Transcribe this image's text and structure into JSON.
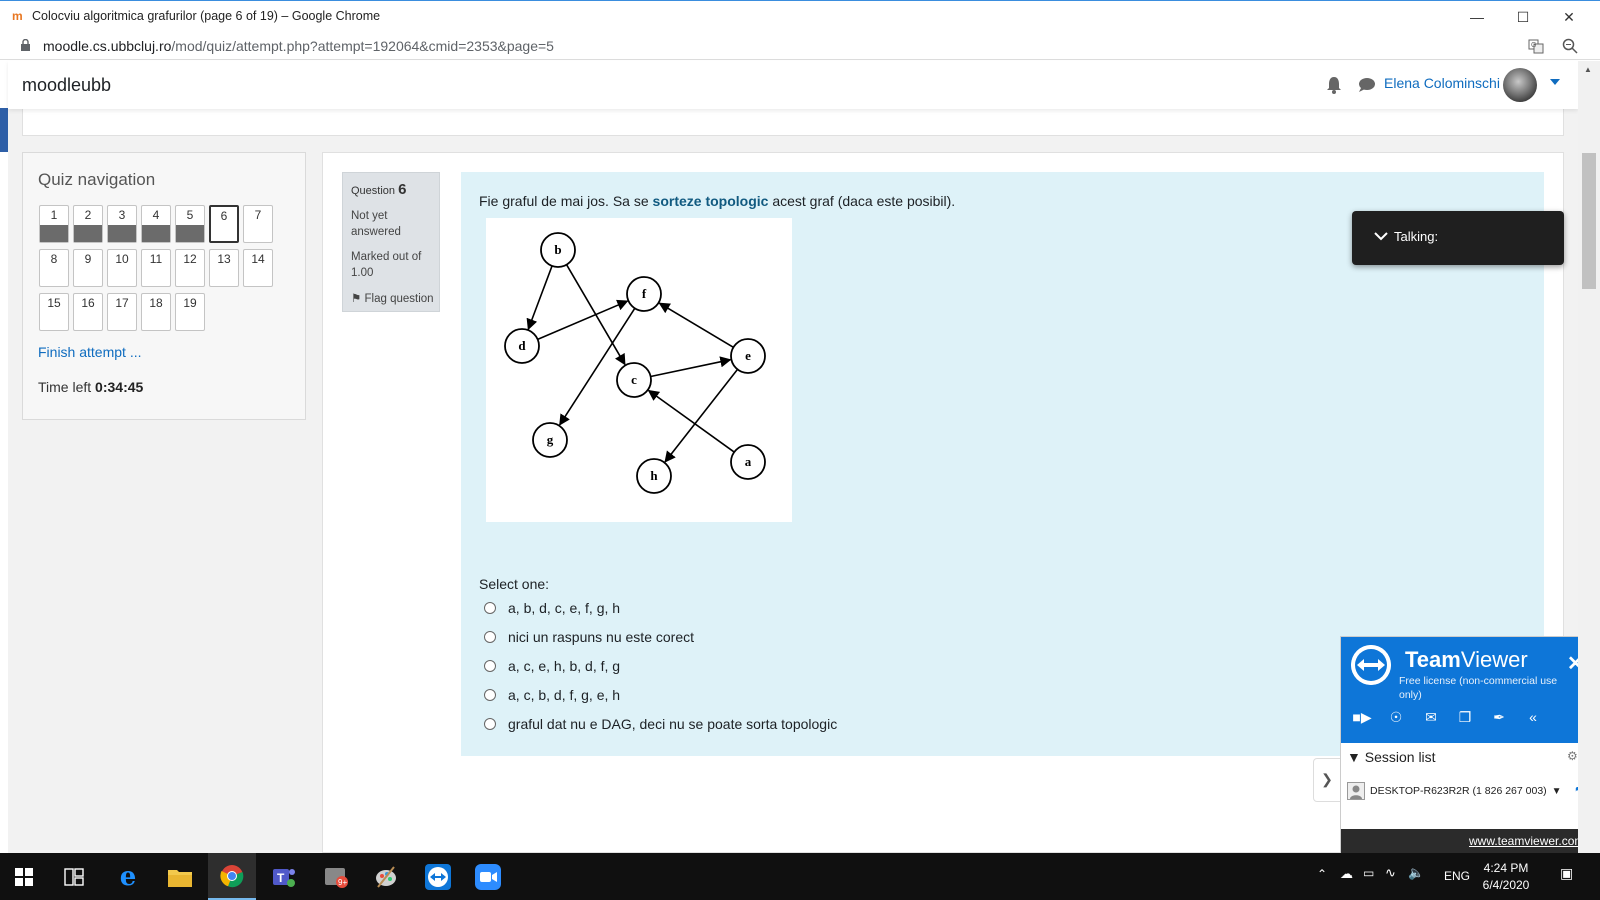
{
  "window": {
    "title": "Colocviu algoritmica grafurilor (page 6 of 19) – Google Chrome",
    "url_host": "moodle.cs.ubbcluj.ro",
    "url_path": "/mod/quiz/attempt.php?attempt=192064&cmid=2353&page=5"
  },
  "header": {
    "brand": "moodleubb",
    "user_name": "Elena Colominschi"
  },
  "quiz_nav": {
    "title": "Quiz navigation",
    "questions": [
      {
        "n": "1",
        "state": "answered"
      },
      {
        "n": "2",
        "state": "answered"
      },
      {
        "n": "3",
        "state": "answered"
      },
      {
        "n": "4",
        "state": "answered"
      },
      {
        "n": "5",
        "state": "answered"
      },
      {
        "n": "6",
        "state": "current"
      },
      {
        "n": "7",
        "state": "unanswered"
      },
      {
        "n": "8",
        "state": "unanswered"
      },
      {
        "n": "9",
        "state": "unanswered"
      },
      {
        "n": "10",
        "state": "unanswered"
      },
      {
        "n": "11",
        "state": "unanswered"
      },
      {
        "n": "12",
        "state": "unanswered"
      },
      {
        "n": "13",
        "state": "unanswered"
      },
      {
        "n": "14",
        "state": "unanswered"
      },
      {
        "n": "15",
        "state": "unanswered"
      },
      {
        "n": "16",
        "state": "unanswered"
      },
      {
        "n": "17",
        "state": "unanswered"
      },
      {
        "n": "18",
        "state": "unanswered"
      },
      {
        "n": "19",
        "state": "unanswered"
      }
    ],
    "finish_label": "Finish attempt ...",
    "time_left_label": "Time left",
    "time_left_value": "0:34:45"
  },
  "question": {
    "label": "Question",
    "number": "6",
    "state": "Not yet answered",
    "marks": "Marked out of 1.00",
    "flag": "Flag question",
    "text_before": "Fie graful de mai jos. Sa se ",
    "text_bold": "sorteze topologic",
    "text_after": " acest graf (daca este posibil).",
    "prompt": "Select one:",
    "options": [
      "a, b, d, c, e, f, g, h",
      "nici un raspuns nu este corect",
      "a, c, e, h, b, d, f, g",
      "a, c, b, d, f, g, e, h",
      "graful dat nu e DAG, deci nu se poate sorta topologic"
    ]
  },
  "graph": {
    "nodes": [
      "b",
      "f",
      "d",
      "c",
      "e",
      "g",
      "h",
      "a"
    ],
    "edges": [
      [
        "b",
        "d"
      ],
      [
        "b",
        "c"
      ],
      [
        "d",
        "f"
      ],
      [
        "f",
        "g"
      ],
      [
        "e",
        "f"
      ],
      [
        "c",
        "e"
      ],
      [
        "e",
        "h"
      ],
      [
        "a",
        "c"
      ]
    ]
  },
  "talking": {
    "label": "Talking:"
  },
  "teamviewer": {
    "name_bold": "Team",
    "name_rest": "Viewer",
    "license": "Free license (non-commercial use only)",
    "session_list": "Session list",
    "device": "DESKTOP-R623R2R (1 826 267 003)",
    "link": "www.teamviewer.com"
  },
  "taskbar": {
    "lang": "ENG",
    "time": "4:24 PM",
    "date": "6/4/2020"
  },
  "colors": {
    "link": "#0f6cbf",
    "formulation_bg": "#def2f8",
    "teamviewer_blue": "#0e76d8"
  }
}
